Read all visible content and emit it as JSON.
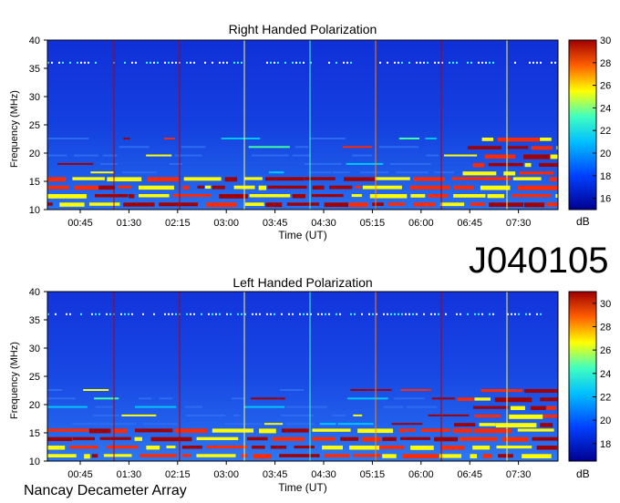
{
  "observation_id": "J040105",
  "footer": "Nancay Decameter Array",
  "chart_data": [
    {
      "type": "heatmap",
      "title": "Right Handed Polarization",
      "xlabel": "Time (UT)",
      "ylabel": "Frequency (MHz)",
      "x_ticks": [
        "00:45",
        "01:30",
        "02:15",
        "03:00",
        "03:45",
        "04:30",
        "05:15",
        "06:00",
        "06:45",
        "07:30"
      ],
      "y_ticks": [
        10,
        15,
        20,
        25,
        30,
        35,
        40
      ],
      "ylim": [
        10,
        40
      ],
      "colorbar": {
        "label": "dB",
        "ticks": [
          16,
          18,
          20,
          22,
          24,
          26,
          28,
          30
        ],
        "range": [
          15,
          30
        ]
      },
      "emission_bands_mhz": [
        11,
        12.5,
        14,
        15.5,
        16.5,
        18,
        19.5,
        21,
        22.5
      ],
      "interference_line_mhz": 36
    },
    {
      "type": "heatmap",
      "title": "Left Handed Polarization",
      "xlabel": "Time (UT)",
      "ylabel": "Frequency (MHz)",
      "x_ticks": [
        "00:45",
        "01:30",
        "02:15",
        "03:00",
        "03:45",
        "04:30",
        "05:15",
        "06:00",
        "06:45",
        "07:30"
      ],
      "y_ticks": [
        10,
        15,
        20,
        25,
        30,
        35,
        40
      ],
      "ylim": [
        10,
        40
      ],
      "colorbar": {
        "label": "dB",
        "ticks": [
          18,
          20,
          22,
          24,
          26,
          28,
          30
        ],
        "range": [
          16.5,
          31
        ]
      },
      "emission_bands_mhz": [
        11,
        12.5,
        14,
        15.5,
        16.5,
        18,
        19.5,
        21,
        22.5
      ],
      "interference_line_mhz": 36
    }
  ]
}
